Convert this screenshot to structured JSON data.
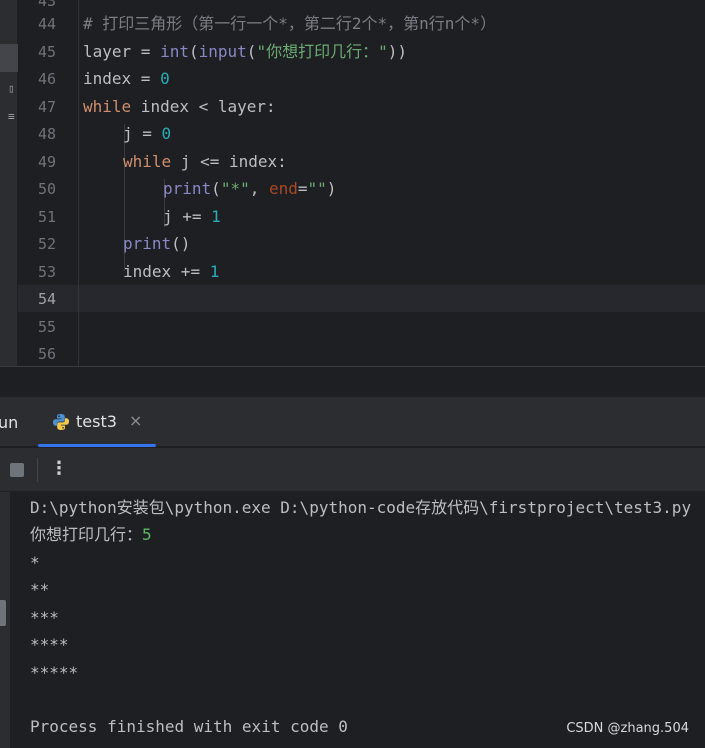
{
  "editor": {
    "line_numbers": [
      "43",
      "44",
      "45",
      "46",
      "47",
      "48",
      "49",
      "50",
      "51",
      "52",
      "53",
      "54",
      "55",
      "56"
    ],
    "lines": {
      "l44": {
        "comment": "# 打印三角形（第一行一个*，第二行2个*，第n行n个*）"
      },
      "l45": {
        "a": "layer",
        "b": " = ",
        "c": "int",
        "d": "(",
        "e": "input",
        "f": "(",
        "g": "\"你想打印几行：\"",
        "h": "))"
      },
      "l46": {
        "a": "index",
        "b": " = ",
        "c": "0"
      },
      "l47": {
        "a": "while",
        "b": " index < layer:"
      },
      "l48": {
        "a": "j",
        "b": " = ",
        "c": "0"
      },
      "l49": {
        "a": "while",
        "b": " j <= index:"
      },
      "l50": {
        "a": "print",
        "b": "(",
        "c": "\"*\"",
        "d": ", ",
        "e": "end",
        "f": "=",
        "g": "\"\"",
        "h": ")"
      },
      "l51": {
        "a": "j",
        "b": " += ",
        "c": "1"
      },
      "l52": {
        "a": "print",
        "b": "()"
      },
      "l53": {
        "a": "index",
        "b": " += ",
        "c": "1"
      }
    }
  },
  "run_panel": {
    "label": "un",
    "tab_label": "test3",
    "tab_close": "×",
    "more_icon": "⋮"
  },
  "console": {
    "command": "D:\\python安装包\\python.exe D:\\python-code存放代码\\firstproject\\test3.py",
    "prompt": "你想打印几行：",
    "input_value": "5",
    "output": [
      "*",
      "**",
      "***",
      "****",
      "*****"
    ],
    "finish": "Process finished with exit code 0"
  },
  "watermark": "CSDN @zhang.504",
  "colors": {
    "background": "#1e1f22",
    "keyword": "#cf8e6d",
    "builtin": "#8888c6",
    "string": "#6aab73",
    "number": "#2aacb8",
    "accent": "#3574f0"
  }
}
